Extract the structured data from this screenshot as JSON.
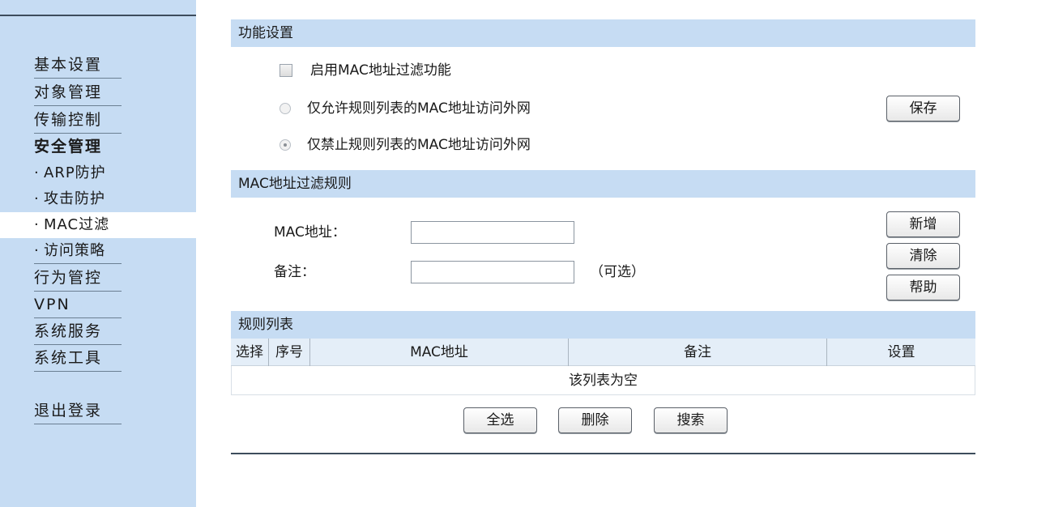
{
  "sidebar": {
    "items": [
      {
        "label": "基本设置"
      },
      {
        "label": "对象管理"
      },
      {
        "label": "传输控制"
      },
      {
        "label": "安全管理"
      },
      {
        "label": "ARP防护"
      },
      {
        "label": "攻击防护"
      },
      {
        "label": "MAC过滤"
      },
      {
        "label": "访问策略"
      },
      {
        "label": "行为管控"
      },
      {
        "label": "VPN"
      },
      {
        "label": "系统服务"
      },
      {
        "label": "系统工具"
      },
      {
        "label": "退出登录"
      }
    ],
    "bullet": "·",
    "active_item": "MAC过滤"
  },
  "function_settings": {
    "title": "功能设置",
    "enable_label": "启用MAC地址过滤功能",
    "enable_checked": false,
    "allow_label": "仅允许规则列表的MAC地址访问外网",
    "deny_label": "仅禁止规则列表的MAC地址访问外网",
    "selected_mode": "deny",
    "save_button": "保存"
  },
  "filter_rules": {
    "title": "MAC地址过滤规则",
    "mac_label": "MAC地址：",
    "mac_value": "",
    "note_label": "备注：",
    "note_value": "",
    "optional_hint": "（可选）",
    "add_button": "新增",
    "clear_button": "清除",
    "help_button": "帮助"
  },
  "rule_list": {
    "title": "规则列表",
    "columns": [
      "选择",
      "序号",
      "MAC地址",
      "备注",
      "设置"
    ],
    "empty_text": "该列表为空",
    "select_all_button": "全选",
    "delete_button": "删除",
    "search_button": "搜索"
  }
}
